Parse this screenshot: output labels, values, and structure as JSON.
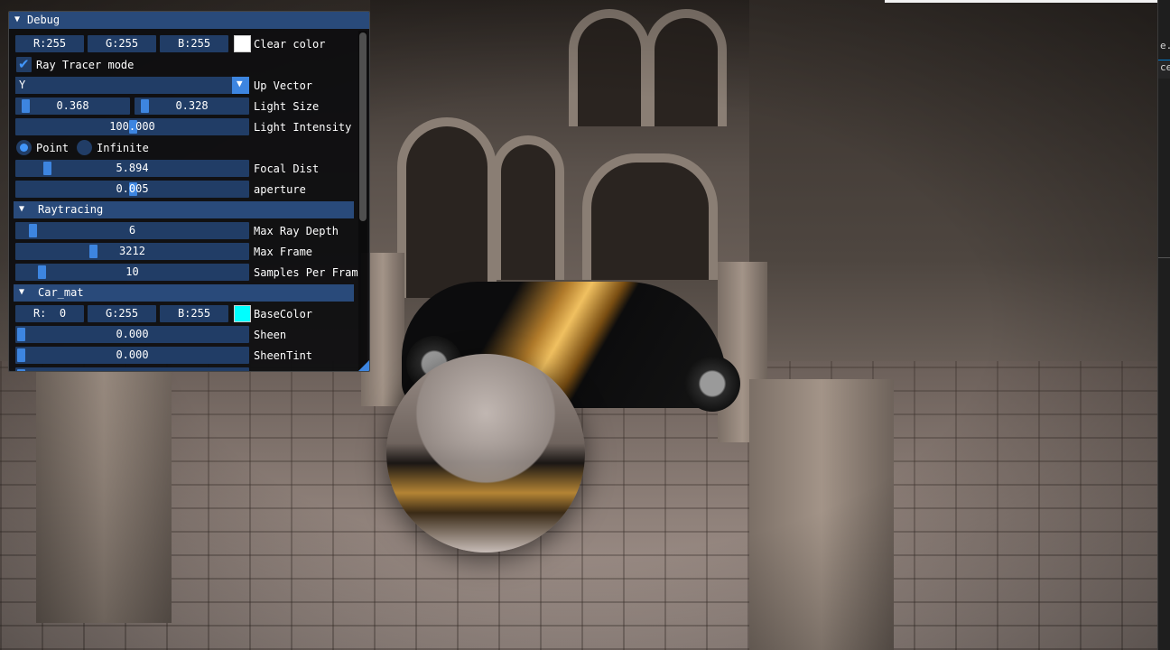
{
  "debug_window": {
    "title": "Debug",
    "clear_color": {
      "r": "R:255",
      "g": "G:255",
      "b": "B:255",
      "label": "Clear color",
      "swatch": "#ffffff"
    },
    "ray_tracer_mode": {
      "label": "Ray Tracer mode",
      "checked": true
    },
    "up_vector": {
      "value": "Y",
      "label": "Up Vector"
    },
    "light_size": {
      "v1": "0.368",
      "v2": "0.328",
      "label": "Light Size"
    },
    "light_intensity": {
      "value": "100.000",
      "label": "Light Intensity"
    },
    "light_type": {
      "option1": "Point",
      "option2": "Infinite",
      "selected": "Point"
    },
    "focal_dist": {
      "value": "5.894",
      "label": "Focal Dist"
    },
    "aperture": {
      "value": "0.005",
      "label": "aperture"
    },
    "raytracing": {
      "title": "Raytracing",
      "max_ray_depth": {
        "value": "6",
        "label": "Max Ray Depth"
      },
      "max_frame": {
        "value": "3212",
        "label": "Max Frame"
      },
      "samples_per_frame": {
        "value": "10",
        "label": "Samples Per Fram"
      }
    },
    "car_mat": {
      "title": "Car_mat",
      "base_color": {
        "r": "R:  0",
        "g": "G:255",
        "b": "B:255",
        "label": "BaseColor",
        "swatch": "#00ffff"
      },
      "sheen": {
        "value": "0.000",
        "label": "Sheen"
      },
      "sheen_tint": {
        "value": "0.000",
        "label": "SheenTint"
      }
    }
  },
  "editor_strip": {
    "frag1": "e.r",
    "frag2": "ce"
  },
  "colors": {
    "accent": "#3d85e0",
    "frame_bg": "#213d66",
    "title_bg": "#294a7a"
  }
}
